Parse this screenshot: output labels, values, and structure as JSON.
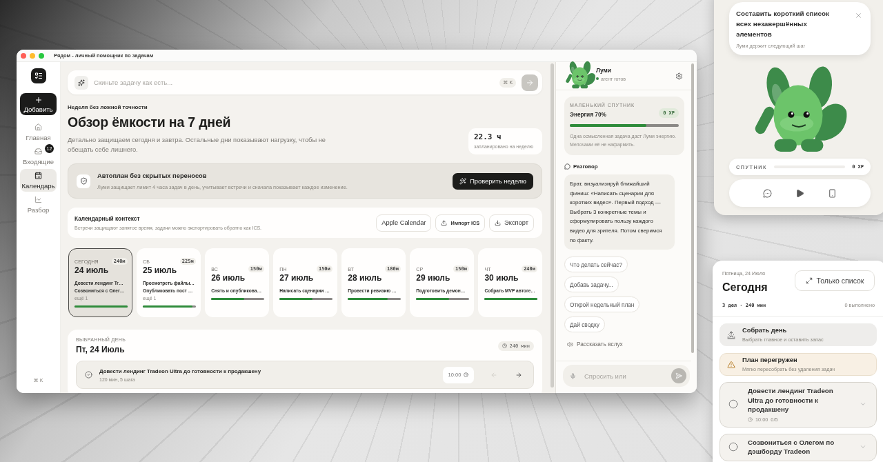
{
  "window": {
    "title": "Рядом - личный помощник по задачам"
  },
  "sidebar": {
    "add_label": "Добавить",
    "items": [
      {
        "label": "Главная",
        "selected": false
      },
      {
        "label": "Входящие",
        "badge": "12",
        "selected": false
      },
      {
        "label": "Календарь",
        "selected": true
      },
      {
        "label": "Разбор",
        "selected": false
      }
    ],
    "shortcut": "⌘ K"
  },
  "search": {
    "placeholder": "Скиньте задачу как есть...",
    "shortcut": "⌘ K"
  },
  "overview": {
    "eyebrow": "Неделя без ложной точности",
    "title": "Обзор ёмкости на 7 дней",
    "description": "Детально защищаем сегодня и завтра. Остальные дни показывают нагрузку, чтобы не обещать себе лишнего.",
    "stat": {
      "value": "22.3 ч",
      "caption": "запланировано на неделю"
    }
  },
  "autoplan": {
    "title": "Автоплан без скрытых переносов",
    "text": "Луми защищает лимит 4 часа задач в день, учитывает встречи и сначала показывает каждое изменение.",
    "button": "Проверить неделю"
  },
  "calendar_context": {
    "title": "Календарный контекст",
    "text": "Встречи защищают занятое время, задачи можно экспортировать обратно как ICS.",
    "buttons": [
      {
        "label": "Apple Calendar",
        "kind": "plain"
      },
      {
        "label": "Импорт ICS",
        "kind": "import"
      },
      {
        "label": "Экспорт",
        "kind": "export"
      }
    ]
  },
  "days": [
    {
      "label": "СЕГОДНЯ",
      "minutes": "240м",
      "date": "24 июль",
      "tasks": [
        "Довести лендинг Tr…",
        "Созвониться с Олег…"
      ],
      "more": "ещё 1",
      "level": 1,
      "selected": true
    },
    {
      "label": "СБ",
      "minutes": "225м",
      "date": "25 июль",
      "tasks": [
        "Просмотреть файлы…",
        "Опубликовать пост …"
      ],
      "more": "ещё 1",
      "level": 0.94,
      "selected": false
    },
    {
      "label": "ВС",
      "minutes": "150м",
      "date": "26 июль",
      "tasks": [
        "Снять и опубликова…"
      ],
      "level": 0.62,
      "selected": false
    },
    {
      "label": "ПН",
      "minutes": "150м",
      "date": "27 июль",
      "tasks": [
        "Написать сценарии …"
      ],
      "level": 0.62,
      "selected": false
    },
    {
      "label": "ВТ",
      "minutes": "180м",
      "date": "28 июль",
      "tasks": [
        "Провести ревизию …"
      ],
      "level": 0.75,
      "selected": false
    },
    {
      "label": "СР",
      "minutes": "150м",
      "date": "29 июль",
      "tasks": [
        "Подготовить демон…"
      ],
      "level": 0.62,
      "selected": false
    },
    {
      "label": "ЧТ",
      "minutes": "240м",
      "date": "30 июль",
      "tasks": [
        "Собрать MVP автоге…"
      ],
      "level": 1,
      "selected": false
    }
  ],
  "selected_day": {
    "eyebrow": "ВЫБРАННЫЙ ДЕНЬ",
    "title": "Пт, 24 Июль",
    "total": "240 мин",
    "tasks": [
      {
        "title": "Довести лендинг Tradeon Ultra до готовности к продакшену",
        "meta": "120 мин, 5 шага",
        "time": "10:00",
        "move_back_disabled": true
      }
    ]
  },
  "assistant": {
    "name": "Луми",
    "status": "агент готов",
    "companion": {
      "eyebrow": "МАЛЕНЬКИЙ СПУТНИК",
      "title": "Энергия 70%",
      "xp": "0 XP",
      "level": 0.7,
      "text": "Одна осмысленная задача даст Луми энергию. Мелочами её не нафармить."
    },
    "conversation_title": "Разговор",
    "messages": [
      {
        "text": "Брат, визуализируй ближайший финиш: «Написать сценарии для коротких видео». Первый подход — Выбрать 3 конкретные темы и сформулировать пользу каждого видео для зрителя. Потом сверимся по факту."
      }
    ],
    "suggestions": [
      "Что делать сейчас?",
      "Добавь задачу...",
      "Открой недельный план",
      "Дай сводку"
    ],
    "speak_button": "Рассказать вслух",
    "input": {
      "placeholder": "Спросить или"
    }
  },
  "companion_widget": {
    "notification": {
      "title": "Составить короткий список всех незавершённых элементов",
      "text": "Луми держит следующий шаг"
    },
    "xp": {
      "label": "СПУТНИК",
      "value": "0 XP"
    }
  },
  "today_panel": {
    "date": "Пятница, 24 Июля",
    "title": "Сегодня",
    "button": "Только список",
    "summary": "3 дел · 240 мин",
    "done": "0 выполнено",
    "actions": [
      {
        "kind": "plan",
        "title": "Собрать день",
        "text": "Выбрать главное и оставить запас"
      },
      {
        "kind": "warning",
        "title": "План перегружен",
        "text": "Мягко пересобрать без удаления задач"
      }
    ],
    "tasks": [
      {
        "title": "Довести лендинг Tradeon Ultra до готовности к продакшену",
        "time": "10:00",
        "progress": "0/5",
        "done": false
      },
      {
        "title": "Созвониться с Олегом по дэшборду Tradeon",
        "done": false
      }
    ]
  }
}
